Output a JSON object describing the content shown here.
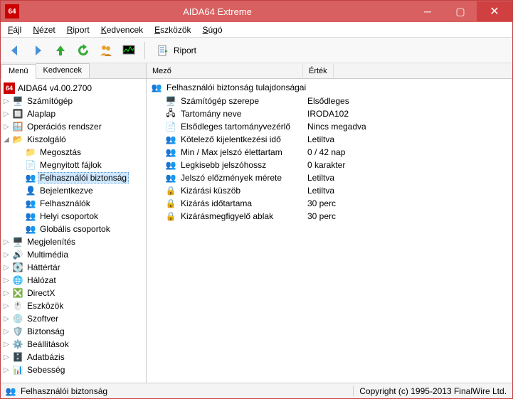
{
  "titlebar": {
    "title": "AIDA64 Extreme",
    "app_badge": "64"
  },
  "menubar": [
    {
      "u": "F",
      "rest": "ájl"
    },
    {
      "u": "N",
      "rest": "ézet"
    },
    {
      "u": "R",
      "rest": "iport"
    },
    {
      "u": "K",
      "rest": "edvencek"
    },
    {
      "u": "E",
      "rest": "szközök"
    },
    {
      "u": "S",
      "rest": "úgó"
    }
  ],
  "toolbar": {
    "report_label": "Riport"
  },
  "tabs": {
    "menu": "Menü",
    "favs": "Kedvencek"
  },
  "tree": {
    "root": "AIDA64 v4.00.2700",
    "top": [
      {
        "icon": "🖥️",
        "label": "Számítógép"
      },
      {
        "icon": "🔲",
        "label": "Alaplap"
      },
      {
        "icon": "🪟",
        "label": "Operációs rendszer"
      }
    ],
    "server": {
      "label": "Kiszolgáló",
      "icon": "📂",
      "children": [
        {
          "icon": "📁",
          "label": "Megosztás"
        },
        {
          "icon": "📄",
          "label": "Megnyitott fájlok"
        },
        {
          "icon": "👥",
          "label": "Felhasználói biztonság",
          "selected": true
        },
        {
          "icon": "👤",
          "label": "Bejelentkezve"
        },
        {
          "icon": "👥",
          "label": "Felhasználók"
        },
        {
          "icon": "👥",
          "label": "Helyi csoportok"
        },
        {
          "icon": "👥",
          "label": "Globális csoportok"
        }
      ]
    },
    "rest": [
      {
        "icon": "🖥️",
        "label": "Megjelenítés"
      },
      {
        "icon": "🔊",
        "label": "Multimédia"
      },
      {
        "icon": "💽",
        "label": "Háttértár"
      },
      {
        "icon": "🌐",
        "label": "Hálózat"
      },
      {
        "icon": "❎",
        "label": "DirectX"
      },
      {
        "icon": "🖱️",
        "label": "Eszközök"
      },
      {
        "icon": "💿",
        "label": "Szoftver"
      },
      {
        "icon": "🛡️",
        "label": "Biztonság"
      },
      {
        "icon": "⚙️",
        "label": "Beállítások"
      },
      {
        "icon": "🗄️",
        "label": "Adatbázis"
      },
      {
        "icon": "📊",
        "label": "Sebesség"
      }
    ]
  },
  "list": {
    "headers": {
      "field": "Mező",
      "value": "Érték"
    },
    "group": {
      "icon": "👥",
      "label": "Felhasználói biztonság tulajdonságai"
    },
    "rows": [
      {
        "icon": "🖥️",
        "field": "Számítógép szerepe",
        "value": "Elsődleges"
      },
      {
        "icon": "🖧",
        "field": "Tartomány neve",
        "value": "IRODA102"
      },
      {
        "icon": "📄",
        "field": "Elsődleges tartományvezérlő",
        "value": "Nincs megadva"
      },
      {
        "icon": "👥",
        "field": "Kötelező kijelentkezési idő",
        "value": "Letiltva"
      },
      {
        "icon": "👥",
        "field": "Min / Max jelszó élettartam",
        "value": "0 / 42 nap"
      },
      {
        "icon": "👥",
        "field": "Legkisebb jelszóhossz",
        "value": "0 karakter"
      },
      {
        "icon": "👥",
        "field": "Jelszó előzmények mérete",
        "value": "Letiltva"
      },
      {
        "icon": "🔒",
        "field": "Kizárási küszöb",
        "value": "Letiltva"
      },
      {
        "icon": "🔒",
        "field": "Kizárás időtartama",
        "value": "30 perc"
      },
      {
        "icon": "🔒",
        "field": "Kizárásmegfigyelő ablak",
        "value": "30 perc"
      }
    ]
  },
  "statusbar": {
    "left_icon": "👥",
    "left": "Felhasználói biztonság",
    "right": "Copyright (c) 1995-2013 FinalWire Ltd."
  }
}
